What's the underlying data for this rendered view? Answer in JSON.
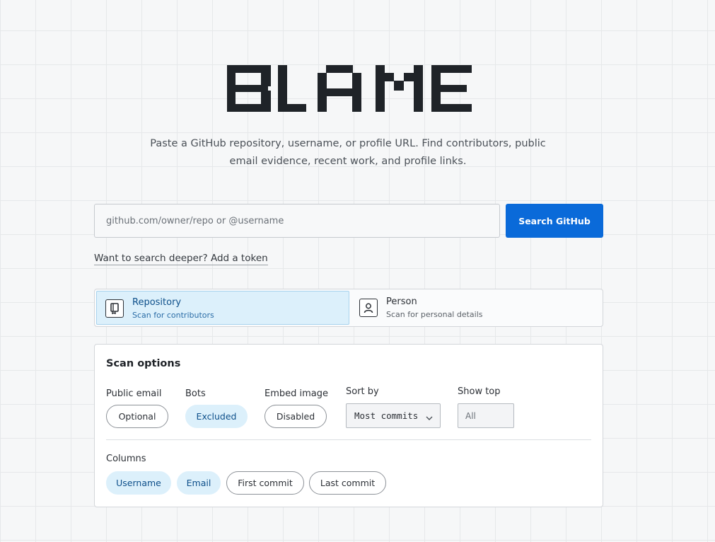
{
  "logo": {
    "text": "BLAME"
  },
  "tagline": {
    "line1": "Paste a GitHub repository, username, or profile URL. Find contributors, public",
    "line2": "email evidence, recent work, and profile links."
  },
  "search": {
    "placeholder": "github.com/owner/repo or @username",
    "button_label": "Search GitHub"
  },
  "token_link": "Want to search deeper? Add a token",
  "modes": [
    {
      "title": "Repository",
      "subtitle": "Scan for contributors",
      "icon": "repo-icon",
      "selected": true
    },
    {
      "title": "Person",
      "subtitle": "Scan for personal details",
      "icon": "person-icon",
      "selected": false
    }
  ],
  "scan_options": {
    "title": "Scan options",
    "public_email": {
      "label": "Public email",
      "value": "Optional"
    },
    "bots": {
      "label": "Bots",
      "value": "Excluded"
    },
    "embed_image": {
      "label": "Embed image",
      "value": "Disabled"
    },
    "sort_by": {
      "label": "Sort by",
      "value": "Most commits"
    },
    "show_top": {
      "label": "Show top",
      "placeholder": "All"
    },
    "columns": {
      "label": "Columns",
      "items": [
        {
          "label": "Username",
          "active": true
        },
        {
          "label": "Email",
          "active": true
        },
        {
          "label": "First commit",
          "active": false
        },
        {
          "label": "Last commit",
          "active": false
        }
      ]
    }
  },
  "colors": {
    "accent": "#0a6ad9",
    "selected_bg": "#dcf0fb",
    "selected_text": "#0d4f8a",
    "logo": "#1f2328"
  }
}
